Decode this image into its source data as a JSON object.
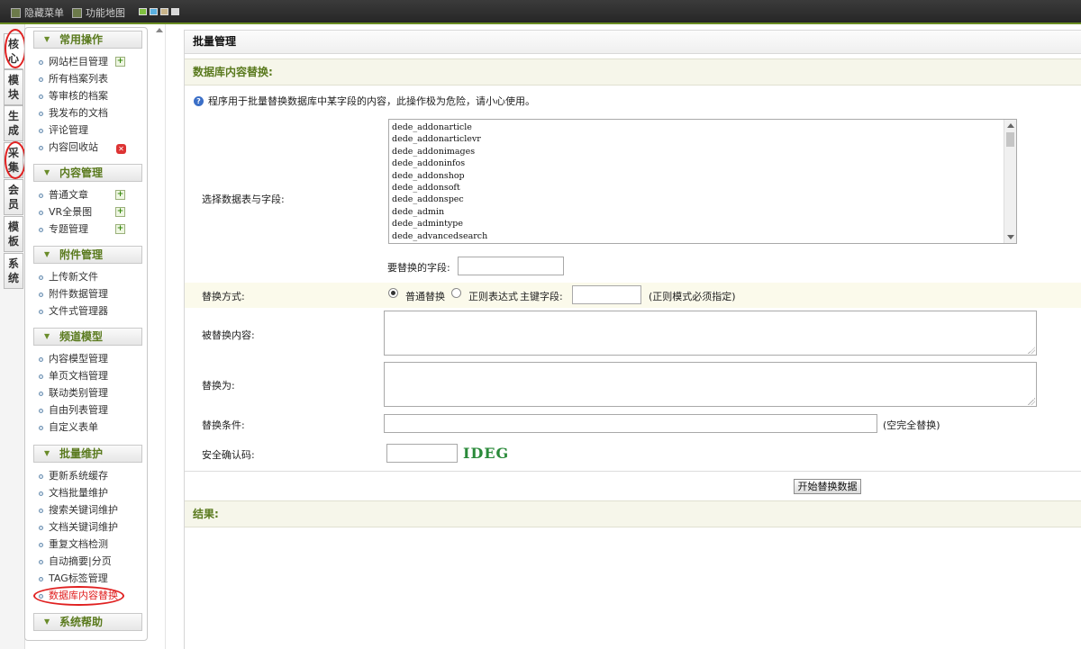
{
  "topbar": {
    "hide_menu": "隐藏菜单",
    "site_map": "功能地图",
    "swatch_colors": [
      "#7fbf3f",
      "#5ab0e0",
      "#c8b48a",
      "#d8d8d8"
    ]
  },
  "vtabs": [
    {
      "label": "核心",
      "active": true
    },
    {
      "label": "模块"
    },
    {
      "label": "生成"
    },
    {
      "label": "采集"
    },
    {
      "label": "会员"
    },
    {
      "label": "模板"
    },
    {
      "label": "系统"
    }
  ],
  "menu": {
    "groups": [
      {
        "title": "常用操作",
        "items": [
          {
            "label": "网站栏目管理",
            "icon": "add-icon"
          },
          {
            "label": "所有档案列表"
          },
          {
            "label": "等审核的档案"
          },
          {
            "label": "我发布的文档"
          },
          {
            "label": "评论管理"
          },
          {
            "label": "内容回收站",
            "icon": "delete-icon"
          }
        ]
      },
      {
        "title": "内容管理",
        "items": [
          {
            "label": "普通文章",
            "icon": "add-icon"
          },
          {
            "label": "VR全景图",
            "icon": "add-icon"
          },
          {
            "label": "专题管理",
            "icon": "add-icon"
          }
        ]
      },
      {
        "title": "附件管理",
        "items": [
          {
            "label": "上传新文件"
          },
          {
            "label": "附件数据管理"
          },
          {
            "label": "文件式管理器"
          }
        ]
      },
      {
        "title": "频道模型",
        "items": [
          {
            "label": "内容模型管理"
          },
          {
            "label": "单页文档管理"
          },
          {
            "label": "联动类别管理"
          },
          {
            "label": "自由列表管理"
          },
          {
            "label": "自定义表单"
          }
        ]
      },
      {
        "title": "批量维护",
        "items": [
          {
            "label": "更新系统缓存"
          },
          {
            "label": "文档批量维护"
          },
          {
            "label": "搜索关键词维护"
          },
          {
            "label": "文档关键词维护"
          },
          {
            "label": "重复文档检测"
          },
          {
            "label": "自动摘要|分页"
          },
          {
            "label": "TAG标签管理"
          },
          {
            "label": "数据库内容替换",
            "current": true
          }
        ]
      },
      {
        "title": "系统帮助",
        "items": []
      }
    ]
  },
  "main": {
    "title": "批量管理",
    "section": "数据库内容替换:",
    "notice": "程序用于批量替换数据库中某字段的内容，此操作极为危险，请小心使用。",
    "select_label": "选择数据表与字段:",
    "tables": [
      "dede_addonarticle",
      "dede_addonarticlevr",
      "dede_addonimages",
      "dede_addoninfos",
      "dede_addonshop",
      "dede_addonsoft",
      "dede_addonspec",
      "dede_admin",
      "dede_admintype",
      "dede_advancedsearch"
    ],
    "field_label": "要替换的字段:",
    "field_value": "",
    "mode_label": "替换方式:",
    "mode_normal": "普通替换",
    "mode_regex": "正则表达式",
    "key_label": "主键字段:",
    "key_value": "",
    "key_hint": "(正则模式必须指定)",
    "replaced_label": "被替换内容:",
    "replaced_value": "",
    "replace_to_label": "替换为:",
    "replace_to_value": "",
    "condition_label": "替换条件:",
    "condition_value": "",
    "condition_hint": "(空完全替换)",
    "captcha_label": "安全确认码:",
    "captcha_value": "",
    "captcha_text": "IDEG",
    "submit": "开始替换数据",
    "result_label": "结果:"
  }
}
